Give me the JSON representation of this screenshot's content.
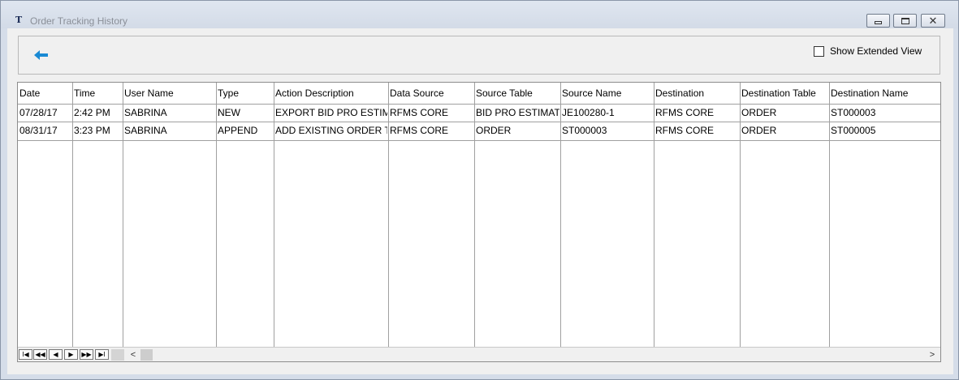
{
  "window": {
    "title": "Order Tracking History",
    "app_icon": "T",
    "controls": [
      "minimize-icon",
      "maximize-icon",
      "close-icon"
    ]
  },
  "toolbar": {
    "back_icon": "back-arrow-icon",
    "back_color": "#1a8ad4",
    "show_extended_label": "Show Extended View",
    "show_extended_checked": false
  },
  "table": {
    "columns": [
      "Date",
      "Time",
      "User Name",
      "Type",
      "Action Description",
      "Data Source",
      "Source Table",
      "Source Name",
      "Destination",
      "Destination Table",
      "Destination Name"
    ],
    "rows": [
      [
        "07/28/17",
        "2:42 PM",
        "SABRINA",
        "NEW",
        "EXPORT BID PRO ESTIMATE",
        "RFMS CORE",
        "BID PRO ESTIMATE",
        "JE100280-1",
        "RFMS CORE",
        "ORDER",
        "ST000003"
      ],
      [
        "08/31/17",
        "3:23 PM",
        "SABRINA",
        "APPEND",
        "ADD EXISTING ORDER TO",
        "RFMS CORE",
        "ORDER",
        "ST000003",
        "RFMS CORE",
        "ORDER",
        "ST000005"
      ]
    ]
  },
  "navigator": {
    "buttons": [
      {
        "name": "first-record-icon",
        "glyph": "I◀"
      },
      {
        "name": "prev-page-icon",
        "glyph": "◀◀"
      },
      {
        "name": "prev-record-icon",
        "glyph": "◀"
      },
      {
        "name": "next-record-icon",
        "glyph": "▶"
      },
      {
        "name": "next-page-icon",
        "glyph": "▶▶"
      },
      {
        "name": "last-record-icon",
        "glyph": "▶I"
      }
    ],
    "scroll_left_glyph": "<",
    "scroll_right_glyph": ">"
  }
}
